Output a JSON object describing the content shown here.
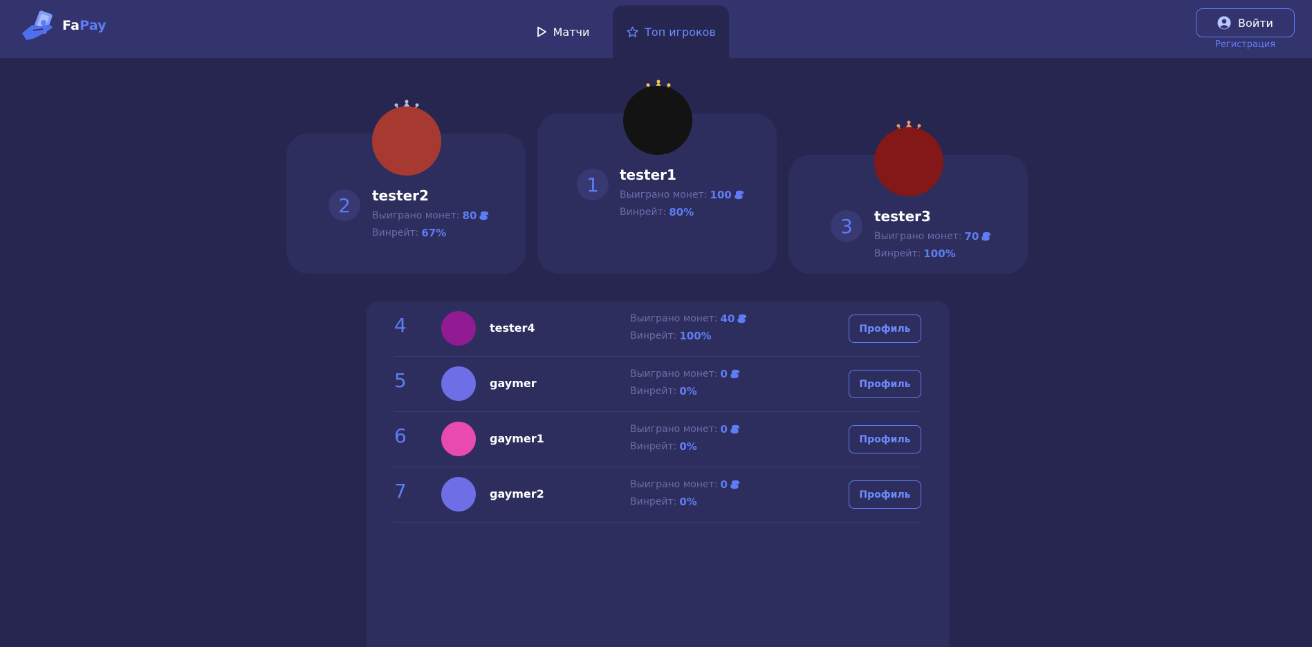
{
  "header": {
    "logo": {
      "part1": "Fa",
      "part2": "Pay"
    },
    "nav": [
      {
        "label": "Матчи",
        "icon": "play-icon"
      },
      {
        "label": "Топ игроков",
        "icon": "star-icon",
        "active": true
      }
    ],
    "login_label": "Войти",
    "register_label": "Регистрация"
  },
  "labels": {
    "coins_won": "Выиграно монет:",
    "winrate": "Винрейт:",
    "profile": "Профиль"
  },
  "podium": [
    {
      "rank": "2",
      "name": "tester2",
      "coins": "80",
      "winrate": "67%",
      "avatar_color": "#a73a30",
      "crown_color": "#b9bdd4"
    },
    {
      "rank": "1",
      "name": "tester1",
      "coins": "100",
      "winrate": "80%",
      "avatar_color": "#131313",
      "crown_color": "#f2c94c"
    },
    {
      "rank": "3",
      "name": "tester3",
      "coins": "70",
      "winrate": "100%",
      "avatar_color": "#841717",
      "crown_color": "#e8946a"
    }
  ],
  "players": [
    {
      "rank": "4",
      "name": "tester4",
      "coins": "40",
      "winrate": "100%",
      "avatar_color": "#921b94"
    },
    {
      "rank": "5",
      "name": "gaymer",
      "coins": "0",
      "winrate": "0%",
      "avatar_color": "#6e6ee6"
    },
    {
      "rank": "6",
      "name": "gaymer1",
      "coins": "0",
      "winrate": "0%",
      "avatar_color": "#e84ab0"
    },
    {
      "rank": "7",
      "name": "gaymer2",
      "coins": "0",
      "winrate": "0%",
      "avatar_color": "#6e6ee6"
    }
  ],
  "colors": {
    "accent": "#5e7df5",
    "background": "#262650",
    "header": "#33336d",
    "card": "#2e2e5e"
  }
}
